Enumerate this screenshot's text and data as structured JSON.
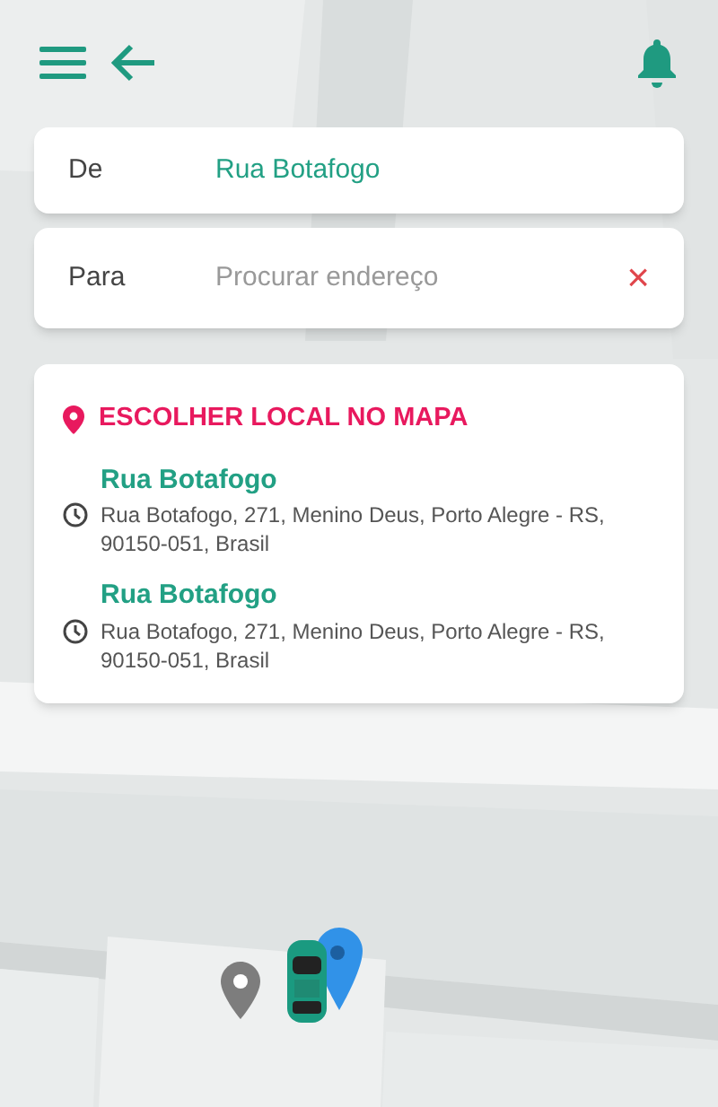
{
  "route": {
    "from": {
      "label": "De",
      "value": "Rua Botafogo"
    },
    "to": {
      "label": "Para",
      "placeholder": "Procurar endereço",
      "clear": "×"
    }
  },
  "suggestions": {
    "pick_on_map": "ESCOLHER LOCAL NO MAPA",
    "items": [
      {
        "title": "Rua Botafogo",
        "address": "Rua Botafogo, 271, Menino Deus, Porto Alegre - RS, 90150-051, Brasil"
      },
      {
        "title": "Rua Botafogo",
        "address": "Rua Botafogo, 271, Menino Deus, Porto Alegre - RS, 90150-051, Brasil"
      }
    ]
  }
}
